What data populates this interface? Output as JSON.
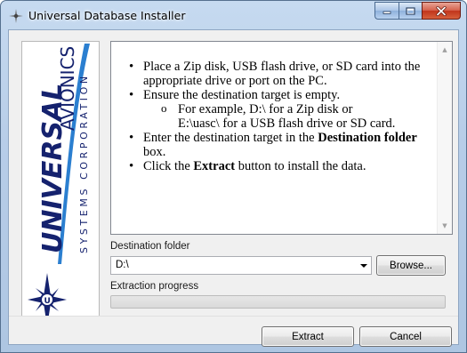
{
  "window": {
    "title": "Universal Database Installer",
    "icon": "compass-rose-icon"
  },
  "logo": {
    "brand": "UNIVERSAL®AVIONICS",
    "subtitle": "SYSTEMS CORPORATION",
    "colors": {
      "navy": "#15226e",
      "accent": "#2b7fd0"
    }
  },
  "instructions": {
    "bullet1": "Place a Zip disk, USB flash drive, or SD card into the appropriate drive or port on the PC.",
    "bullet2": "Ensure the destination target is empty.",
    "sub_line1": "For example, D:\\ for a Zip disk or",
    "sub_line2": "E:\\uasc\\ for a USB flash drive or SD card.",
    "bullet3_pre": "Enter the destination target in the ",
    "bullet3_bold": "Destination folder",
    "bullet3_post": " box.",
    "bullet4_pre": "Click the ",
    "bullet4_bold": "Extract",
    "bullet4_post": " button to install the data."
  },
  "destination": {
    "label": "Destination folder",
    "value": "D:\\",
    "browse_label": "Browse..."
  },
  "progress": {
    "label": "Extraction progress",
    "value": 0
  },
  "buttons": {
    "extract": "Extract",
    "cancel": "Cancel"
  }
}
